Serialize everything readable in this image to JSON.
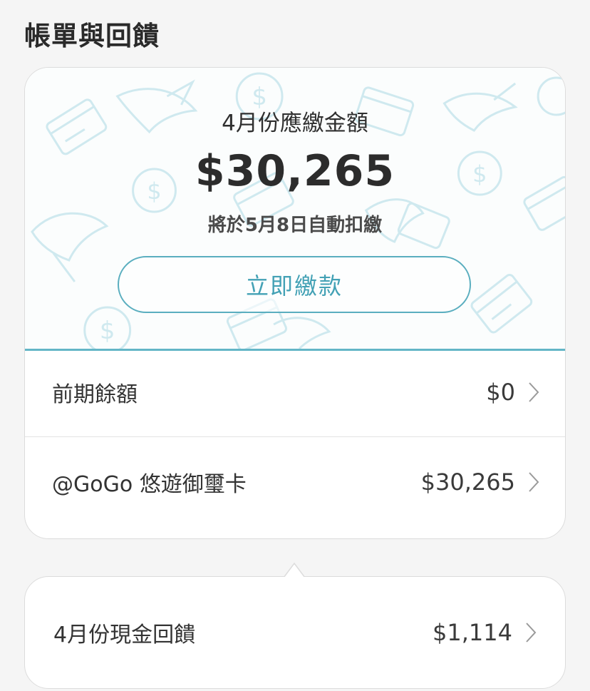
{
  "page": {
    "title": "帳單與回饋"
  },
  "bill": {
    "month_label": "4月份應繳金額",
    "amount": "$30,265",
    "auto_debit_note": "將於5月8日自動扣繳",
    "pay_button_label": "立即繳款"
  },
  "details": [
    {
      "label": "前期餘額",
      "value": "$0"
    },
    {
      "label": "@GoGo 悠遊御璽卡",
      "value": "$30,265"
    }
  ],
  "cashback": {
    "label": "4月份現金回饋",
    "value": "$1,114"
  },
  "colors": {
    "accent": "#5aaebf",
    "pattern": "#cfe9ef"
  },
  "icons": [
    "chevron-right-icon",
    "credit-card-icon",
    "dollar-coin-icon",
    "bird-illustration"
  ]
}
